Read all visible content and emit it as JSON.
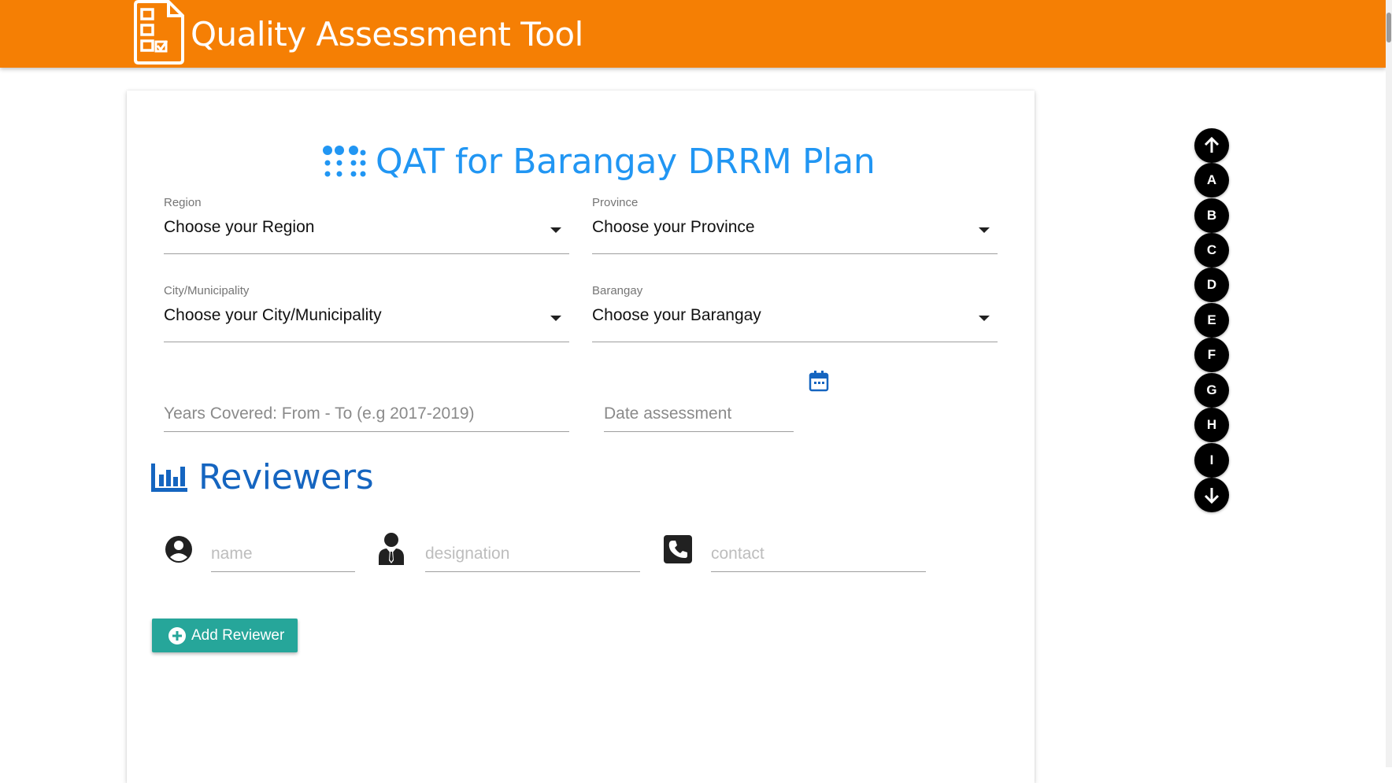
{
  "header": {
    "title": "Quality Assessment Tool",
    "color": "#f57f04"
  },
  "form": {
    "title": "QAT for Barangay DRRM Plan",
    "title_icon": "braille-dots-icon",
    "region": {
      "label": "Region",
      "value": "Choose your Region"
    },
    "province": {
      "label": "Province",
      "value": "Choose your Province"
    },
    "city": {
      "label": "City/Municipality",
      "value": "Choose your City/Municipality"
    },
    "barangay": {
      "label": "Barangay",
      "value": "Choose your Barangay"
    },
    "years_placeholder": "Years Covered: From - To (e.g 2017-2019)",
    "date_placeholder": "Date assessment"
  },
  "reviewers": {
    "title": "Reviewers",
    "name_placeholder": "name",
    "designation_placeholder": "designation",
    "contact_placeholder": "contact",
    "add_label": "Add Reviewer",
    "add_color": "#26a69a"
  },
  "side_nav": {
    "items": [
      "A",
      "B",
      "C",
      "D",
      "E",
      "F",
      "G",
      "H",
      "I"
    ],
    "up_icon": "arrow-up-icon",
    "down_icon": "arrow-down-icon"
  },
  "colors": {
    "accent_blue": "#2196f3",
    "section_blue": "#1565c0"
  }
}
